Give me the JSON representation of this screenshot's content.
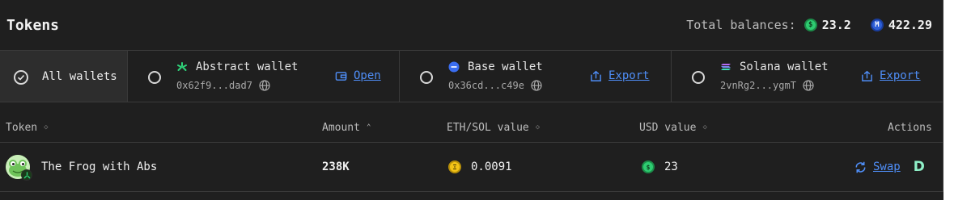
{
  "header": {
    "title": "Tokens",
    "balances_label": "Total balances:",
    "balance_usd": "23.2",
    "balance_other": "422.29"
  },
  "wallets": {
    "all_label": "All wallets",
    "items": [
      {
        "name": "Abstract wallet",
        "address": "0x62f9...dad7",
        "action": "Open",
        "icon": "abstract-logo-icon"
      },
      {
        "name": "Base wallet",
        "address": "0x36cd...c49e",
        "action": "Export",
        "icon": "base-logo-icon"
      },
      {
        "name": "Solana wallet",
        "address": "2vnRg2...ygmT",
        "action": "Export",
        "icon": "solana-logo-icon"
      }
    ]
  },
  "table": {
    "columns": [
      "Token",
      "Amount",
      "ETH/SOL value",
      "USD value",
      "Actions"
    ],
    "rows": [
      {
        "token": "The Frog with Abs",
        "amount": "238K",
        "eth_sol_value": "0.0091",
        "usd_value": "23",
        "action": "Swap"
      }
    ]
  },
  "colors": {
    "accent": "#4f8ef7",
    "usd_green": "#2ecc71",
    "eth_gold": "#f3c316",
    "base_blue": "#3a6df0"
  }
}
